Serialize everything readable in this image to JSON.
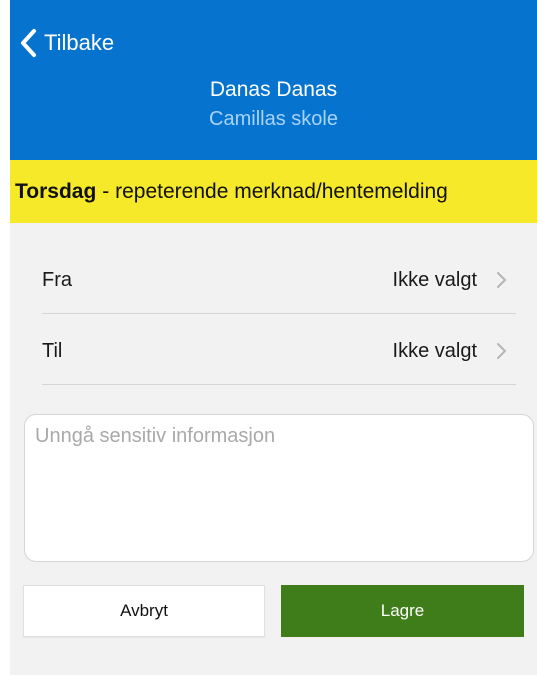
{
  "header": {
    "back_label": "Tilbake",
    "back_icon": "chevron-left-icon",
    "title": "Danas Danas",
    "subtitle": "Camillas skole",
    "background_color": "#0674cf"
  },
  "banner": {
    "day": "Torsdag",
    "text": "- repeterende merknad/hentemelding",
    "background_color": "#f5e92a"
  },
  "form": {
    "rows": [
      {
        "label": "Fra",
        "value": "Ikke valgt",
        "icon": "chevron-right-icon"
      },
      {
        "label": "Til",
        "value": "Ikke valgt",
        "icon": "chevron-right-icon"
      }
    ],
    "note": {
      "value": "",
      "placeholder": "Unngå sensitiv informasjon"
    }
  },
  "actions": {
    "cancel_label": "Avbryt",
    "save_label": "Lagre",
    "save_color": "#3f7d1a"
  }
}
